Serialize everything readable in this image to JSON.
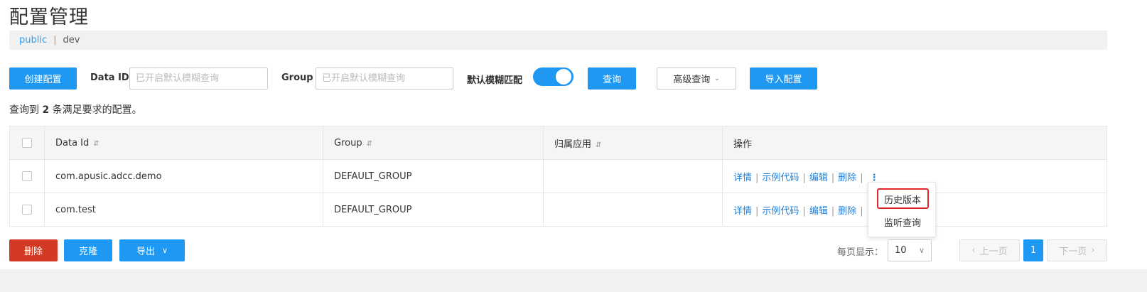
{
  "page": {
    "title": "配置管理"
  },
  "namespace": {
    "active": "public",
    "separator": "|",
    "current": "dev"
  },
  "toolbar": {
    "create_label": "创建配置",
    "data_id_label": "Data ID",
    "data_id_placeholder": "已开启默认模糊查询",
    "group_label": "Group",
    "group_placeholder": "已开启默认模糊查询",
    "fuzzy_label": "默认模糊匹配",
    "fuzzy_enabled": true,
    "query_label": "查询",
    "advanced_label": "高级查询",
    "import_label": "导入配置"
  },
  "result": {
    "prefix": "查询到",
    "count": "2",
    "suffix": "条满足要求的配置。"
  },
  "table": {
    "columns": [
      "Data Id",
      "Group",
      "归属应用",
      "操作"
    ],
    "sort_icon": "⇵",
    "rows": [
      {
        "data_id": "com.apusic.adcc.demo",
        "group": "DEFAULT_GROUP",
        "app": ""
      },
      {
        "data_id": "com.test",
        "group": "DEFAULT_GROUP",
        "app": ""
      }
    ],
    "ops": {
      "detail": "详情",
      "sample": "示例代码",
      "edit": "编辑",
      "delete": "删除",
      "sep": "|",
      "more": "⋮"
    }
  },
  "dropdown": {
    "items": [
      "历史版本",
      "监听查询"
    ],
    "highlighted": "历史版本"
  },
  "bottom": {
    "delete_label": "删除",
    "clone_label": "克隆",
    "export_label": "导出",
    "page_size_label": "每页显示：",
    "page_size": "10",
    "prev_label": "上一页",
    "current_page": "1",
    "next_label": "下一页"
  },
  "colors": {
    "primary": "#1e98f2",
    "danger": "#d33a23",
    "highlight_box": "#e02828",
    "link": "#1e7fd6"
  }
}
